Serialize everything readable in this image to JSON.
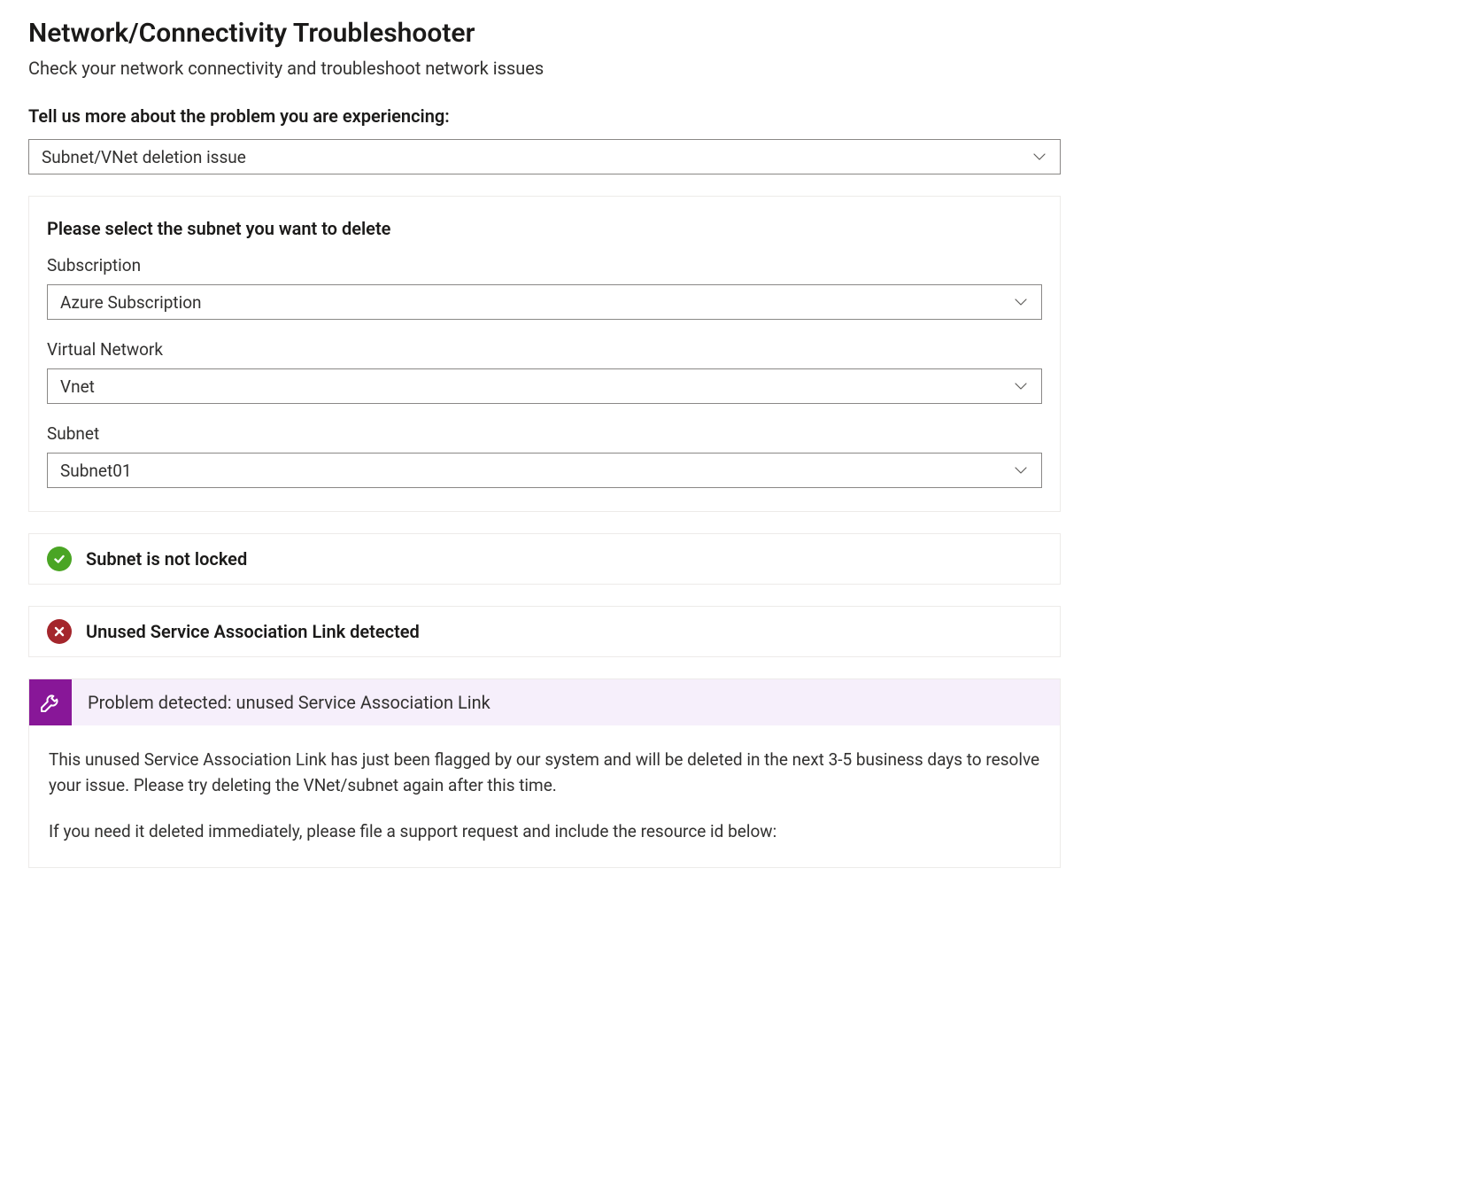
{
  "header": {
    "title": "Network/Connectivity Troubleshooter",
    "subtitle": "Check your network connectivity and troubleshoot network issues"
  },
  "problem_prompt": "Tell us more about the problem you are experiencing:",
  "problem_select": {
    "value": "Subnet/VNet deletion issue"
  },
  "subnet_panel": {
    "title": "Please select the subnet you want to delete",
    "fields": {
      "subscription": {
        "label": "Subscription",
        "value": "Azure Subscription"
      },
      "vnet": {
        "label": "Virtual Network",
        "value": "Vnet"
      },
      "subnet": {
        "label": "Subnet",
        "value": "Subnet01"
      }
    }
  },
  "status": {
    "ok": {
      "text": "Subnet is not locked"
    },
    "error": {
      "text": "Unused Service Association Link detected"
    }
  },
  "detector": {
    "title": "Problem detected: unused Service Association Link",
    "body_p1": "This unused Service Association Link has just been flagged by our system and will be deleted in the next 3-5 business days to resolve your issue. Please try deleting the VNet/subnet again after this time.",
    "body_p2": "If you need it deleted immediately, please file a support request and include the resource id below:"
  }
}
